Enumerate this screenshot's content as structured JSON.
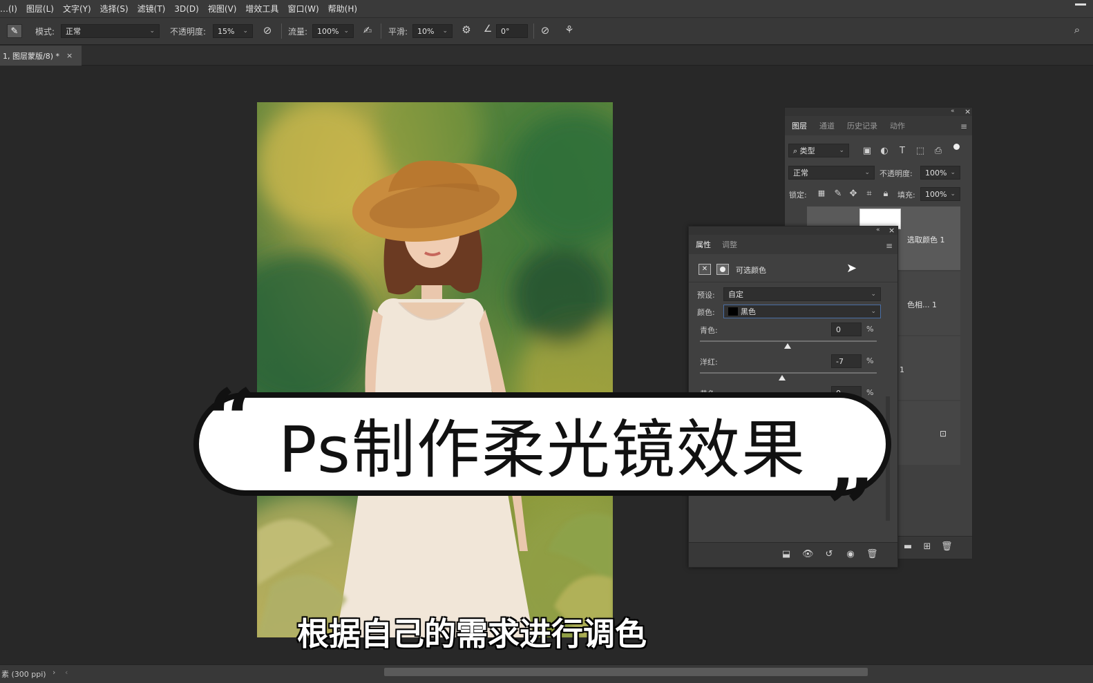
{
  "menubar": {
    "items": [
      "…(I)",
      "图层(L)",
      "文字(Y)",
      "选择(S)",
      "滤镜(T)",
      "3D(D)",
      "视图(V)",
      "增效工具",
      "窗口(W)",
      "帮助(H)"
    ]
  },
  "options": {
    "mode_label": "模式:",
    "mode_value": "正常",
    "opacity_label": "不透明度:",
    "opacity_value": "15%",
    "flow_label": "流量:",
    "flow_value": "100%",
    "smooth_label": "平滑:",
    "smooth_value": "10%",
    "angle_value": "0°"
  },
  "doc_tab": {
    "title": "1, 图层蒙版/8) *",
    "close": "×"
  },
  "layers_panel": {
    "tabs": [
      "图层",
      "通道",
      "历史记录",
      "动作"
    ],
    "filter_label": "类型",
    "blend_mode": "正常",
    "opacity_label": "不透明度:",
    "opacity_value": "100%",
    "lock_label": "锁定:",
    "fill_label": "填充:",
    "fill_value": "100%",
    "layers": [
      "选取颜色 1",
      "色相... 1",
      "1"
    ]
  },
  "props_panel": {
    "tabs": [
      "属性",
      "调整"
    ],
    "adjustment_name": "可选颜色",
    "preset_label": "预设:",
    "preset_value": "自定",
    "color_label": "颜色:",
    "color_value": "黑色",
    "sliders": [
      {
        "label": "青色:",
        "value": "0",
        "unit": "%"
      },
      {
        "label": "洋红:",
        "value": "-7",
        "unit": "%"
      },
      {
        "label": "黄色:",
        "value": "0",
        "unit": "%"
      }
    ]
  },
  "status": {
    "text": "素 (300 ppi)"
  },
  "overlay": {
    "title": "Ps制作柔光镜效果",
    "open_quote": "“",
    "close_quote": "”",
    "subtitle": "根据自己的需求进行调色"
  }
}
